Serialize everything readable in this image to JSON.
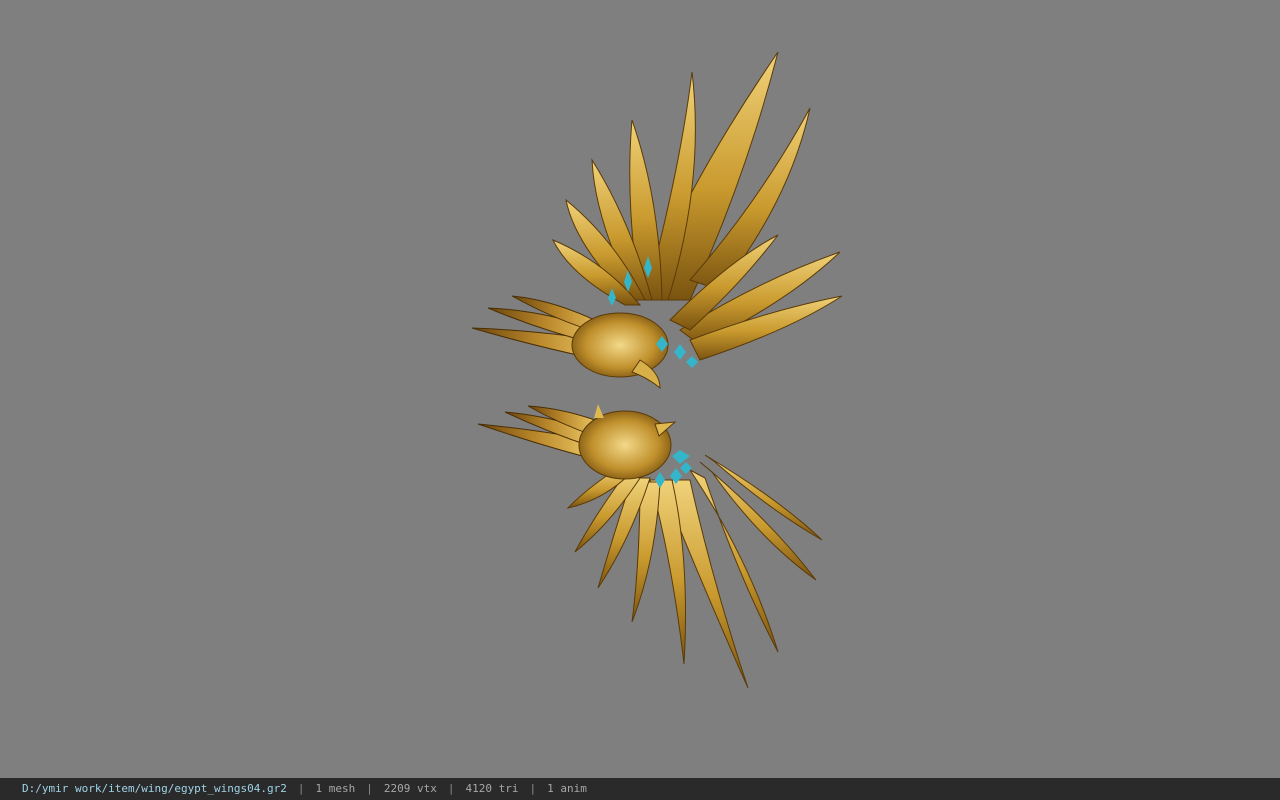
{
  "viewer": {
    "background_color": "#7f7f7f",
    "model_name": "egypt wings",
    "model_colors": {
      "gold_light": "#e8c25a",
      "gold_mid": "#c99a2e",
      "gold_dark": "#7a5310",
      "gem": "#34b5c9"
    }
  },
  "status_bar": {
    "file_path": "D:/ymir work/item/wing/egypt_wings04.gr2",
    "separator": "|",
    "mesh_count": "1 mesh",
    "vertex_count": "2209 vtx",
    "triangle_count": "4120 tri",
    "anim_count": "1 anim"
  }
}
